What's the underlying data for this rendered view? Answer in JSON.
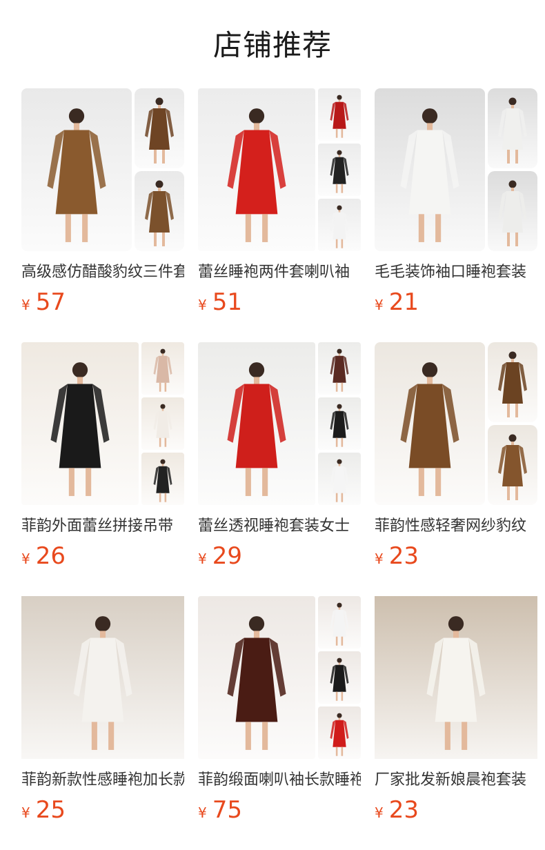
{
  "section": {
    "title": "店铺推荐"
  },
  "products": [
    {
      "name": "高级感仿醋酸豹纹三件套",
      "currency": "¥",
      "price": "57",
      "layout": "main-2",
      "colors": [
        "#8a5a2e",
        "#6e4424",
        "#7b512c"
      ],
      "bg": "#e9e9e9"
    },
    {
      "name": "蕾丝睡袍两件套喇叭袖",
      "currency": "¥",
      "price": "51",
      "layout": "main-3",
      "colors": [
        "#d4201c",
        "#b81818",
        "#222222",
        "#f3f3f3"
      ],
      "bg": "#ececec"
    },
    {
      "name": "毛毛装饰袖口睡袍套装",
      "currency": "¥",
      "price": "21",
      "layout": "main-2",
      "colors": [
        "#f5f5f3",
        "#f0f0ee",
        "#ededeb"
      ],
      "bg": "#dcdcdc"
    },
    {
      "name": "菲韵外面蕾丝拼接吊带",
      "currency": "¥",
      "price": "26",
      "layout": "main-3",
      "colors": [
        "#1a1a1a",
        "#d9b8a6",
        "#f1ece6",
        "#222222"
      ],
      "bg": "#efe9e1"
    },
    {
      "name": "蕾丝透视睡袍套装女士",
      "currency": "¥",
      "price": "29",
      "layout": "main-3",
      "colors": [
        "#cf1f1b",
        "#5a2a22",
        "#1c1c1c",
        "#f5f5f5"
      ],
      "bg": "#ececea"
    },
    {
      "name": "菲韵性感轻奢网纱豹纹",
      "currency": "¥",
      "price": "23",
      "layout": "main-2",
      "colors": [
        "#7a4c26",
        "#6b4322",
        "#84552d"
      ],
      "bg": "#ece7e0"
    },
    {
      "name": "菲韵新款性感睡袍加长款",
      "currency": "¥",
      "price": "25",
      "layout": "single",
      "colors": [
        "#f4f2ee"
      ],
      "bg": "#d8cfc4"
    },
    {
      "name": "菲韵缎面喇叭袖长款睡袍",
      "currency": "¥",
      "price": "75",
      "layout": "main-3",
      "colors": [
        "#4a1c14",
        "#f4f4f4",
        "#1a1a1a",
        "#d01c1a"
      ],
      "bg": "#ede8e4"
    },
    {
      "name": "厂家批发新娘晨袍套装",
      "currency": "¥",
      "price": "23",
      "layout": "single",
      "colors": [
        "#f6f4ef"
      ],
      "bg": "#cdbfae"
    }
  ]
}
